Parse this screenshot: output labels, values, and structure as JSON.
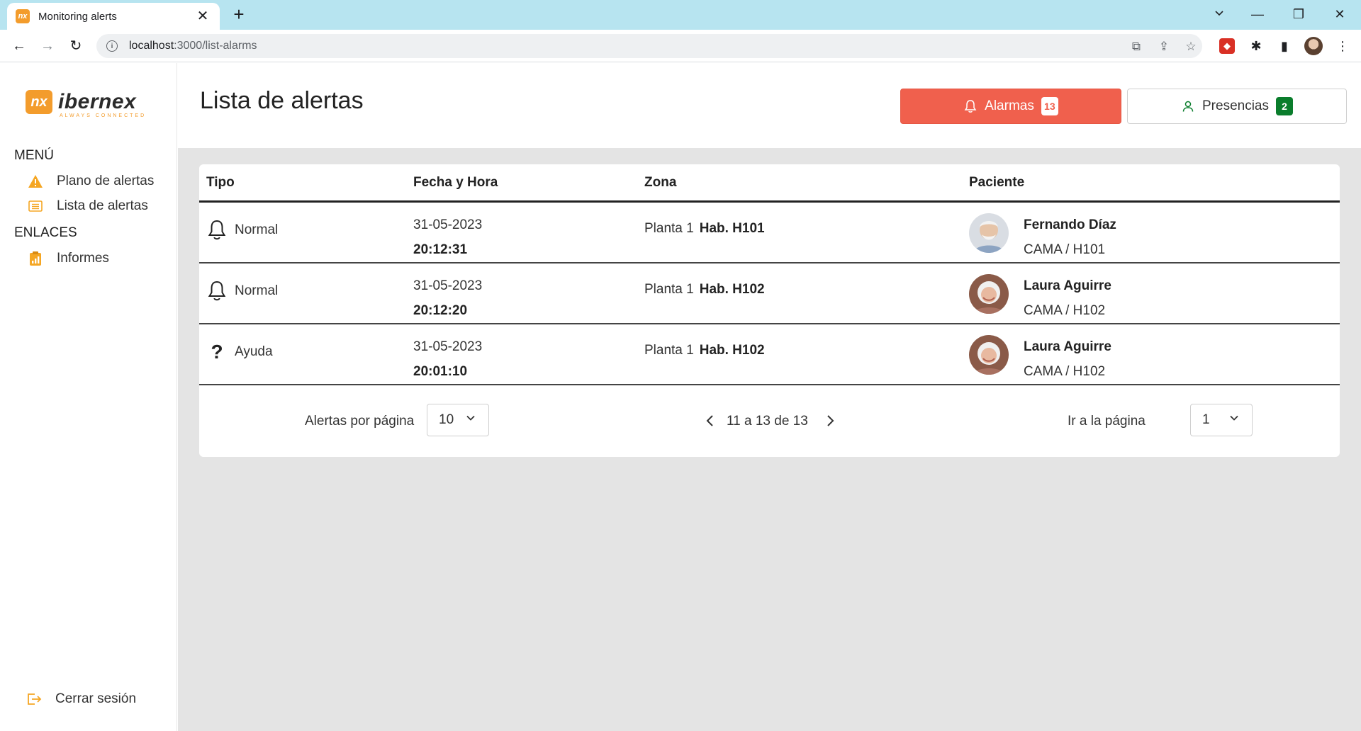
{
  "browser": {
    "tab_title": "Monitoring alerts",
    "tab_favicon": "nx",
    "url_host": "localhost",
    "url_path": ":3000/list-alarms"
  },
  "sidebar": {
    "logo_text": "ibernex",
    "logo_mark": "nx",
    "logo_tagline": "ALWAYS CONNECTED",
    "menu_title": "MENÚ",
    "menu_items": [
      {
        "label": "Plano de alertas",
        "icon": "warning-icon"
      },
      {
        "label": "Lista de alertas",
        "icon": "list-icon"
      }
    ],
    "links_title": "ENLACES",
    "link_items": [
      {
        "label": "Informes",
        "icon": "report-icon"
      }
    ],
    "logout_label": "Cerrar sesión"
  },
  "header": {
    "title": "Lista de alertas",
    "alarms_label": "Alarmas",
    "alarms_count": "13",
    "presences_label": "Presencias",
    "presences_count": "2"
  },
  "table": {
    "columns": [
      "Tipo",
      "Fecha y Hora",
      "Zona",
      "Paciente"
    ],
    "rows": [
      {
        "tipo": "Normal",
        "tipo_icon": "bell-icon",
        "fecha": "31-05-2023",
        "hora": "20:12:31",
        "planta": "Planta 1",
        "hab": "Hab. H101",
        "paciente": "Fernando Díaz",
        "cama": "CAMA / H101"
      },
      {
        "tipo": "Normal",
        "tipo_icon": "bell-icon",
        "fecha": "31-05-2023",
        "hora": "20:12:20",
        "planta": "Planta 1",
        "hab": "Hab. H102",
        "paciente": "Laura Aguirre",
        "cama": "CAMA / H102"
      },
      {
        "tipo": "Ayuda",
        "tipo_icon": "question-icon",
        "fecha": "31-05-2023",
        "hora": "20:01:10",
        "planta": "Planta 1",
        "hab": "Hab. H102",
        "paciente": "Laura Aguirre",
        "cama": "CAMA / H102"
      }
    ]
  },
  "pagination": {
    "per_page_label": "Alertas por página",
    "per_page_value": "10",
    "range_text": "11 a 13 de 13",
    "goto_label": "Ir a la página",
    "goto_value": "1"
  },
  "colors": {
    "alarm_button": "#f0604d",
    "presence_badge": "#0a7d2c",
    "brand_orange": "#f39c2c",
    "tab_strip": "#b7e4f0"
  }
}
